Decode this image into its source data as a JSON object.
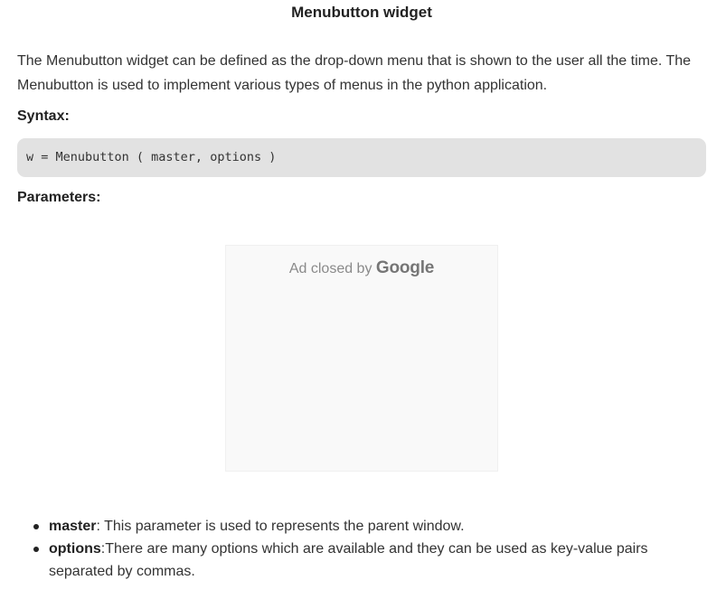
{
  "article": {
    "title": "Menubutton widget",
    "intro": "The Menubutton widget can be defined as the drop-down menu that is shown to the user all the time. The Menubutton is used to implement various types of menus in the python application.",
    "syntax_heading": "Syntax:",
    "syntax_code": "w = Menubutton ( master, options )",
    "parameters_heading": "Parameters:"
  },
  "ad": {
    "label": "Ad closed by",
    "brand": "Google"
  },
  "parameters": [
    {
      "name": "master",
      "description": ": This parameter is used to represents the parent window."
    },
    {
      "name": "options",
      "description": ":There are many options which are available and they can be used as key-value pairs separated by commas."
    }
  ]
}
